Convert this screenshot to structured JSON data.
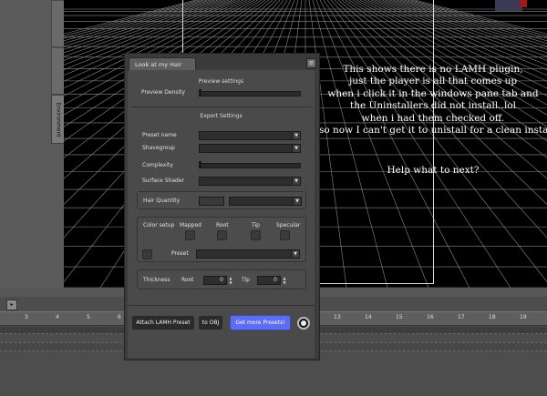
{
  "environment_tab": {
    "label": "Environment"
  },
  "overlay": {
    "lines": [
      "This shows there is no LAMH plugin,",
      "just the player is all that comes up",
      "when i click it in the windows pane tab and",
      "the Uninstallers did not install..lol",
      "when i had them checked off.",
      "so now I can't get it to unistall for a clean install"
    ],
    "help": "Help what to next?"
  },
  "timeline": {
    "ticks": [
      "3",
      "4",
      "5",
      "6",
      "13",
      "14",
      "15",
      "16",
      "17",
      "18",
      "19"
    ]
  },
  "panel": {
    "tab_label": "Look at my Hair",
    "preview": {
      "title": "Preview settings",
      "density_label": "Preview Density",
      "density_level": 0.0
    },
    "export": {
      "title": "Export Settings",
      "preset_name_label": "Preset name",
      "preset_name_value": "",
      "shavegroup_label": "Shavegroup",
      "shavegroup_value": "",
      "complexity_label": "Complexity",
      "complexity_level": 0.0,
      "surface_shader_label": "Surface Shader",
      "surface_shader_value": "",
      "hair_quantity_label": "Hair Quantity",
      "hair_quantity_value": "",
      "hair_quantity_select": ""
    },
    "color_setup": {
      "label": "Color setup",
      "mapped": "Mapped",
      "root": "Root",
      "tip": "Tip",
      "specular": "Specular",
      "preset_label": "Preset",
      "preset_value": ""
    },
    "thickness": {
      "label": "Thickness",
      "root_label": "Root",
      "root_value": "0",
      "tip_label": "Tip",
      "tip_value": "0"
    },
    "buttons": {
      "attach": "Attach LAMH Preset",
      "to_obj": "to OBJ",
      "get_more": "Get more Presets!"
    }
  }
}
